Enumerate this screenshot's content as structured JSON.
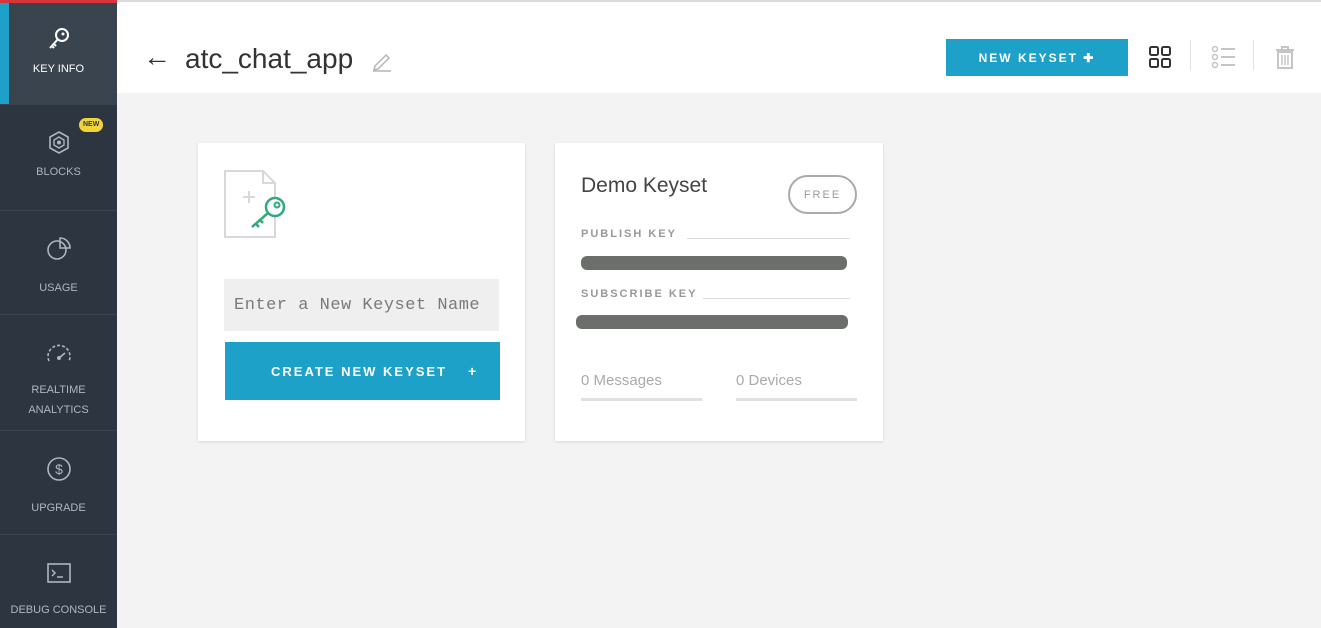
{
  "sidebar": {
    "items": [
      {
        "label": "KEY INFO",
        "icon": "key-icon"
      },
      {
        "label": "BLOCKS",
        "icon": "blocks-icon",
        "badge": "NEW"
      },
      {
        "label": "USAGE",
        "icon": "pie-chart-icon"
      },
      {
        "label": "REALTIME\nANALYTICS",
        "icon": "speedometer-icon"
      },
      {
        "label": "UPGRADE",
        "icon": "dollar-icon"
      },
      {
        "label": "DEBUG CONSOLE",
        "icon": "terminal-icon"
      }
    ]
  },
  "header": {
    "back": "←",
    "title": "atc_chat_app",
    "new_keyset_label": "NEW KEYSET ✚"
  },
  "create_card": {
    "input_placeholder": "Enter a New Keyset Name",
    "button_label": "CREATE NEW KEYSET",
    "button_plus": "+"
  },
  "demo_card": {
    "title": "Demo Keyset",
    "badge": "FREE",
    "publish_key_label": "PUBLISH KEY",
    "subscribe_key_label": "SUBSCRIBE KEY",
    "messages": "0 Messages",
    "devices": "0 Devices"
  },
  "colors": {
    "accent": "#1ea1c8",
    "sidebar_bg": "#2d3640",
    "badge_new": "#f0d43a",
    "key_green": "#2eaa7c"
  }
}
